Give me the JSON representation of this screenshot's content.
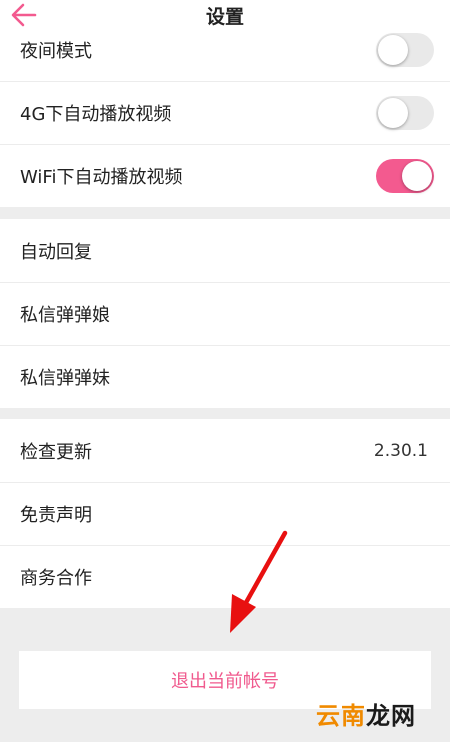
{
  "header": {
    "title": "设置"
  },
  "colors": {
    "accent": "#f35a8f",
    "toggle_off": "#e9e9e9",
    "arrow": "#e81010"
  },
  "section1": [
    {
      "label": "夜间模式",
      "toggle": false
    },
    {
      "label": "4G下自动播放视频",
      "toggle": false
    },
    {
      "label": "WiFi下自动播放视频",
      "toggle": true
    }
  ],
  "section2": [
    {
      "label": "自动回复"
    },
    {
      "label": "私信弹弹娘"
    },
    {
      "label": "私信弹弹妹"
    }
  ],
  "section3": [
    {
      "label": "检查更新",
      "value": "2.30.1"
    },
    {
      "label": "免责声明"
    },
    {
      "label": "商务合作"
    }
  ],
  "logout_label": "退出当前帐号",
  "watermark": {
    "part1": "云南",
    "part2": "龙网"
  },
  "icons": {
    "back": "arrow-left-icon",
    "annotation": "red-arrow-annotation"
  }
}
